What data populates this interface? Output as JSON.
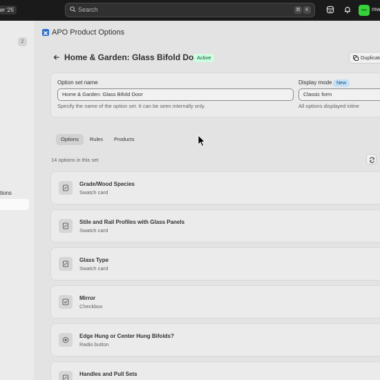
{
  "topbar": {
    "store_name": "er '25",
    "search_placeholder": "Search",
    "shortcut_keys": [
      "⌘",
      "K"
    ],
    "avatar_initials": "mw",
    "user_name": "mw"
  },
  "sidebar": {
    "badge": "2",
    "item_fragment": "tions"
  },
  "app": {
    "title": "APO Product Options"
  },
  "page": {
    "title": "Home & Garden: Glass Bifold Door",
    "status": "Active",
    "duplicate_label": "Duplicate"
  },
  "form": {
    "name_label": "Option set name",
    "name_value": "Home & Garden: Glass Bifold Door",
    "name_help": "Specify the name of the option set. It can be seen internally only.",
    "mode_label": "Display mode",
    "mode_badge": "New",
    "mode_value": "Classic form",
    "mode_help": "All options displayed inline"
  },
  "tabs": [
    {
      "label": "Options",
      "active": true
    },
    {
      "label": "Rules",
      "active": false
    },
    {
      "label": "Products",
      "active": false
    }
  ],
  "options_count": "14 options in this set",
  "options": [
    {
      "name": "Grade/Wood Species",
      "type": "Swatch card",
      "icon": "swatch-icon"
    },
    {
      "name": "Stile and Rail Profiles with Glass Panels",
      "type": "Swatch card",
      "icon": "swatch-icon"
    },
    {
      "name": "Glass Type",
      "type": "Swatch card",
      "icon": "swatch-icon"
    },
    {
      "name": "Mirror",
      "type": "Checkbox",
      "icon": "checkbox-icon"
    },
    {
      "name": "Edge Hung or Center Hung Bifolds?",
      "type": "Radio button",
      "icon": "radio-icon"
    },
    {
      "name": "Handles and Pull Sets",
      "type": "Swatch card",
      "icon": "swatch-icon"
    }
  ],
  "colors": {
    "topbar": "#1a1a1a",
    "page_bg": "#e3e3e3",
    "card_bg": "#ebebeb",
    "active_badge": "#cdfee1",
    "new_badge": "#c8e0f7",
    "avatar": "#36d13b",
    "logo": "#2c6ecb"
  }
}
